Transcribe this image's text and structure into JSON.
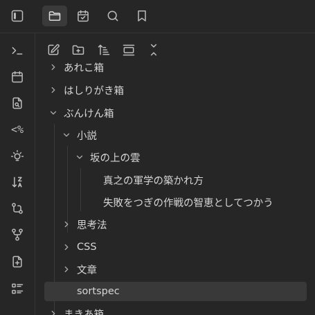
{
  "top_bar": {
    "tabs": [
      {
        "name": "sidebar-toggle",
        "icon": "sidebar-toggle-icon"
      },
      {
        "name": "files",
        "icon": "folder-icon",
        "active": true
      },
      {
        "name": "calendar",
        "icon": "calendar-check-icon"
      },
      {
        "name": "search",
        "icon": "search-icon"
      },
      {
        "name": "bookmarks",
        "icon": "bookmark-icon"
      }
    ]
  },
  "ribbon": {
    "items": [
      {
        "icon": "terminal-icon",
        "text": ""
      },
      {
        "icon": "calendar-icon",
        "text": ""
      },
      {
        "icon": "file-search-icon",
        "text": ""
      },
      {
        "icon": "percent-code-icon",
        "text": "<%"
      },
      {
        "icon": "lightbulb-icon",
        "text": ""
      },
      {
        "icon": "sort-az-icon",
        "text": ""
      },
      {
        "icon": "git-compare-icon",
        "text": ""
      },
      {
        "icon": "git-fork-icon",
        "text": ""
      },
      {
        "icon": "file-plus-icon",
        "text": ""
      },
      {
        "icon": "list-icon",
        "text": ""
      }
    ]
  },
  "file_nav": {
    "buttons": [
      "new-note",
      "new-folder",
      "sort",
      "collapse-toggle",
      "collapse-all"
    ]
  },
  "tree": {
    "items": [
      {
        "label": "あれこ箱",
        "level": 0,
        "chevron": "right"
      },
      {
        "label": "はしりがき箱",
        "level": 0,
        "chevron": "right"
      },
      {
        "label": "ぶんけん箱",
        "level": 0,
        "chevron": "down"
      },
      {
        "label": "小説",
        "level": 1,
        "chevron": "down"
      },
      {
        "label": "坂の上の雲",
        "level": 2,
        "chevron": "down"
      },
      {
        "label": "真之の軍学の築かれ方",
        "level": 3,
        "chevron": ""
      },
      {
        "label": "失敗をつぎの作戦の智恵としてつかう",
        "level": 3,
        "chevron": ""
      },
      {
        "label": "思考法",
        "level": 1,
        "chevron": "right"
      },
      {
        "label": "CSS",
        "level": 1,
        "chevron": "right"
      },
      {
        "label": "文章",
        "level": 1,
        "chevron": "right"
      },
      {
        "label": "sortspec",
        "level": 1,
        "chevron": "",
        "selected": true
      },
      {
        "label": "まきあ箱",
        "level": 0,
        "chevron": "right"
      }
    ]
  },
  "colors": {
    "background": "#262626",
    "selected_row": "#393939",
    "icon": "#bcbcbc",
    "text": "#d6d6d6"
  }
}
